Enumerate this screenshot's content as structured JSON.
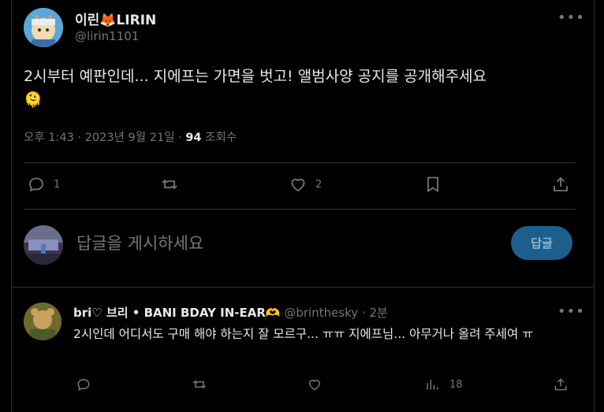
{
  "colors": {
    "background": "#000000",
    "text": "#e7e9ea",
    "muted": "#71767b",
    "accent": "#1d5f8c",
    "divider": "#2f3336"
  },
  "tweet": {
    "author_name": "이린🦊LIRIN",
    "author_handle": "@lirin1101",
    "more_icon": "•••",
    "text_line1": "2시부터 예판인데... 지에프는 가면을 벗고! 앨범사양 공지를 공개해주세요",
    "text_line2": "🫠",
    "time": "오후 1:43",
    "date": "2023년 9월 21일",
    "sep1": " · ",
    "sep2": " · ",
    "views": "94",
    "views_label": "조회수",
    "actions": {
      "reply_count": "1",
      "retweet_count": "",
      "like_count": "2"
    }
  },
  "reply_box": {
    "placeholder": "답글을 게시하세요",
    "button_label": "답글"
  },
  "comment": {
    "author_name": "bri♡ 브리 • BANI BDAY IN-EAR🫶",
    "author_handle": "@brinthesky",
    "time": "2분",
    "sep": " · ",
    "text": "2시인데 어디서도 구매 해야 하는지 잘 모르구... ㅠㅠ 지에프님... 아무거나 올려 주세여 ㅠ",
    "views_count": "18"
  }
}
